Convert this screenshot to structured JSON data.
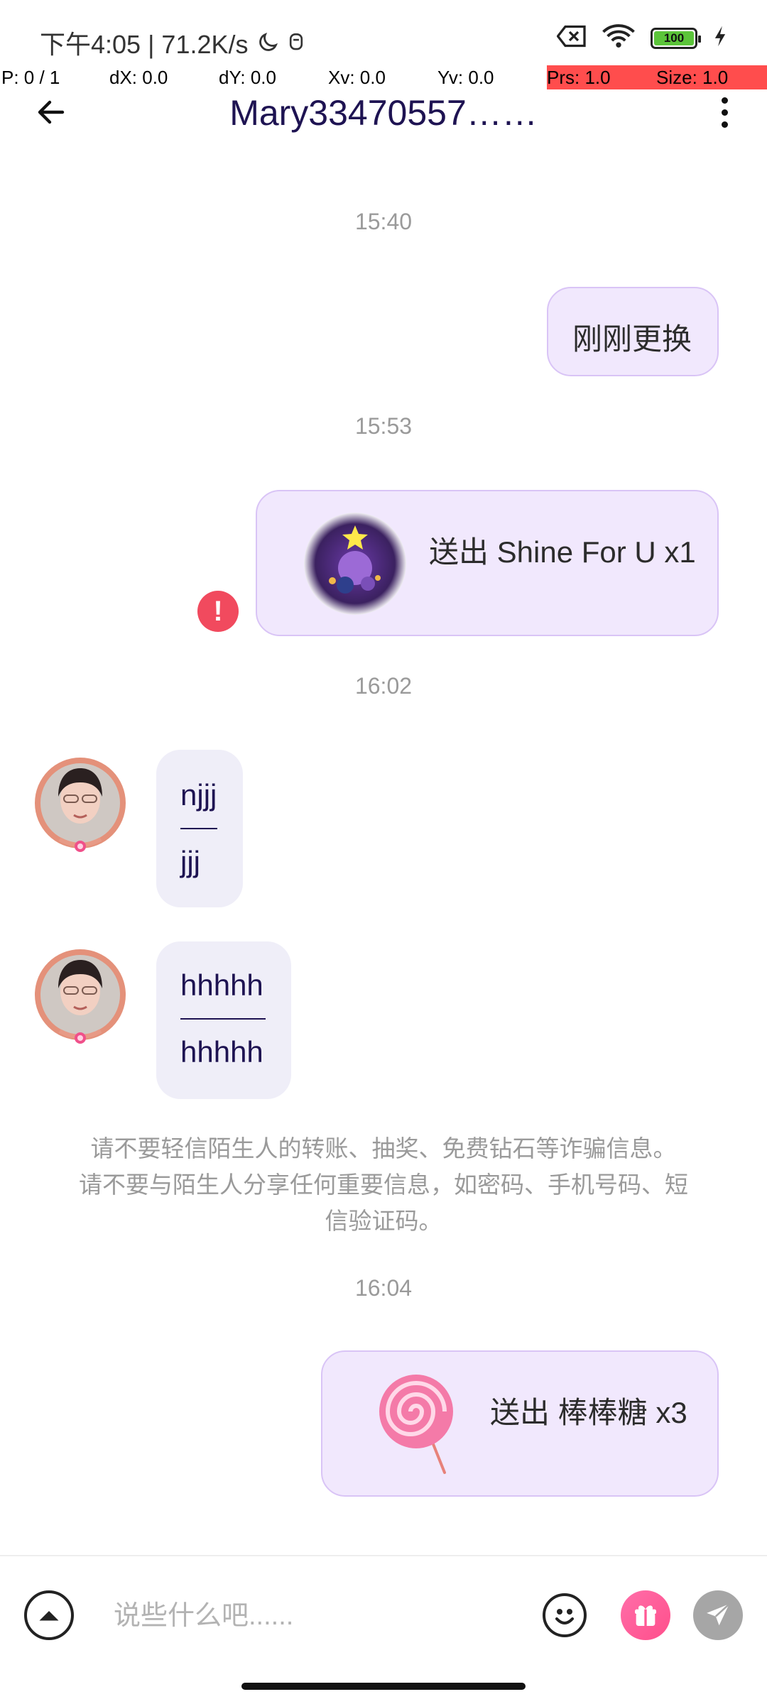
{
  "status_bar": {
    "left_text": "下午4:05 | 71.2K/s",
    "battery": "100"
  },
  "debug": {
    "p": "P: 0 / 1",
    "dx": "dX: 0.0",
    "dy": "dY: 0.0",
    "xv": "Xv: 0.0",
    "yv": "Yv: 0.0",
    "prs": "Prs: 1.0",
    "size": "Size: 1.0"
  },
  "header": {
    "title": "Mary33470557……"
  },
  "messages": {
    "ts1": "15:40",
    "out1": "刚刚更换",
    "ts2": "15:53",
    "gift1": "送出 Shine For U x1",
    "ts3": "16:02",
    "in1_line1": "njjj",
    "in1_line2": "jjj",
    "in2_line1": "hhhhh",
    "in2_line2": "hhhhh",
    "warning": "请不要轻信陌生人的转账、抽奖、免费钻石等诈骗信息。 请不要与陌生人分享任何重要信息，如密码、手机号码、短信验证码。",
    "ts4": "16:04",
    "gift2": "送出 棒棒糖 x3"
  },
  "input": {
    "placeholder": "说些什么吧......"
  },
  "colors": {
    "accent": "#1e1352",
    "outgoing_bubble": "#f1e8fd",
    "incoming_bubble": "#efeef8",
    "error": "#f14a5e",
    "gift_button": "#ff5a95"
  }
}
